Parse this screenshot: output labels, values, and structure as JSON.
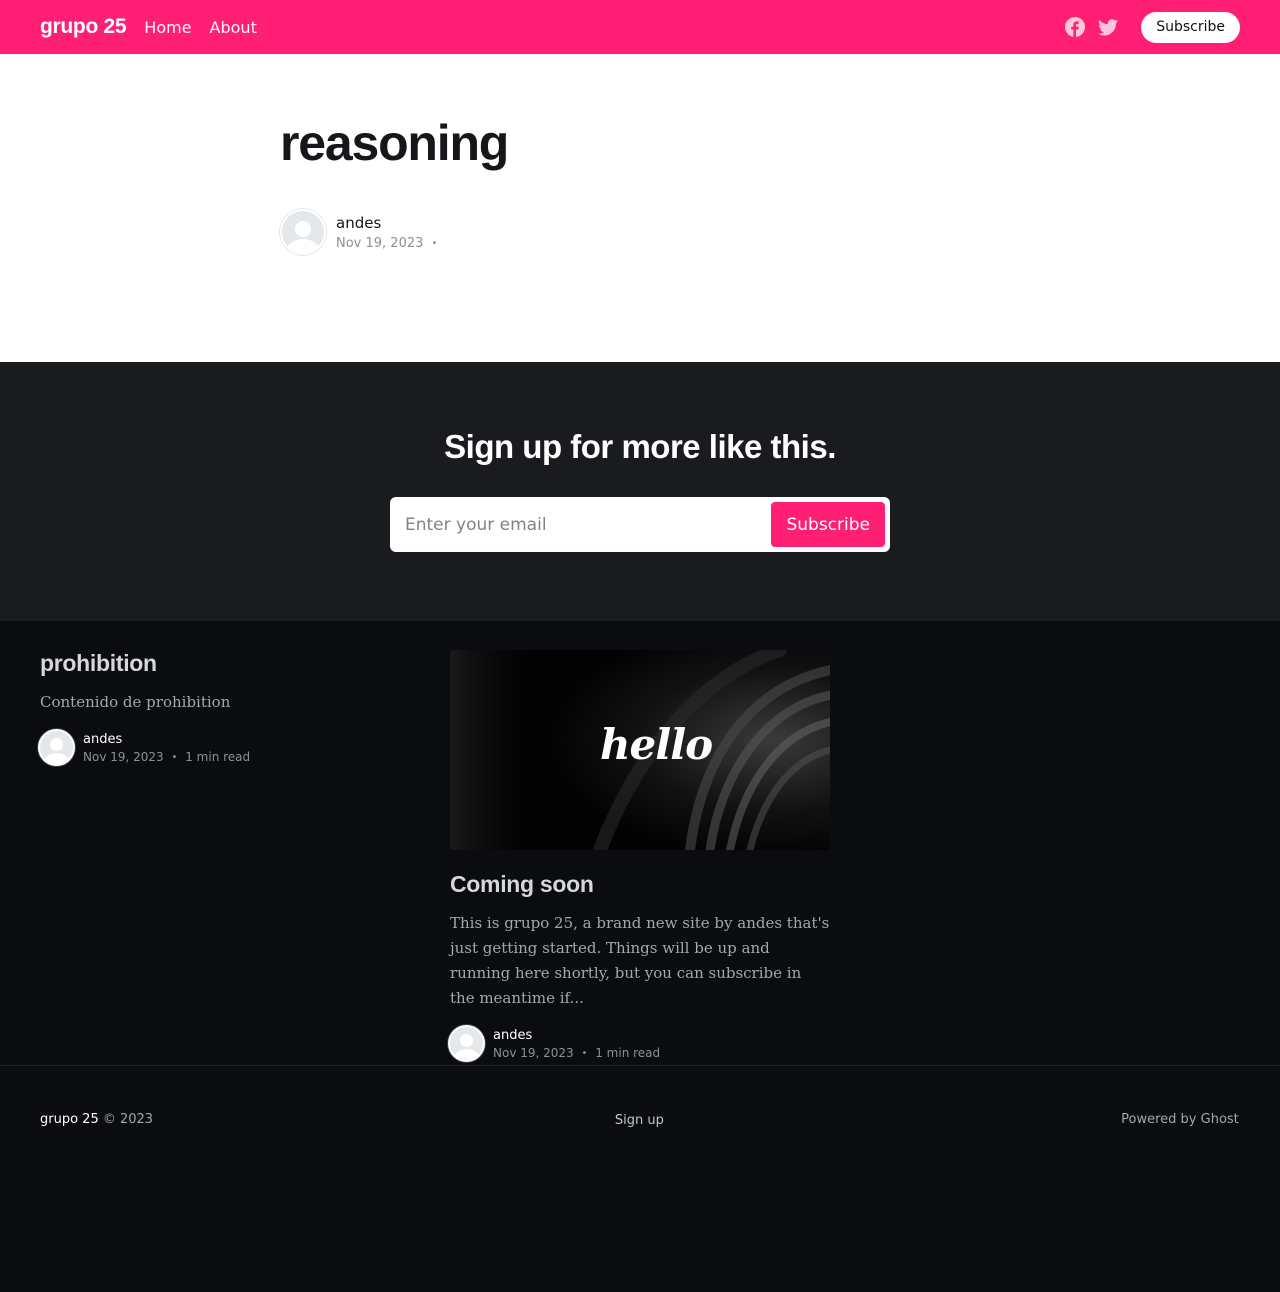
{
  "header": {
    "logo": "grupo 25",
    "nav": [
      "Home",
      "About"
    ],
    "subscribe_label": "Subscribe",
    "social": [
      "facebook-icon",
      "twitter-icon"
    ],
    "accent_color": "#ff1f74"
  },
  "article": {
    "title": "reasoning",
    "author": "andes",
    "date": "Nov 19, 2023",
    "separator": "•"
  },
  "cta": {
    "title": "Sign up for more like this.",
    "email_placeholder": "Enter your email",
    "button_label": "Subscribe"
  },
  "posts": [
    {
      "title": "prohibition",
      "excerpt": "Contenido de prohibition",
      "author": "andes",
      "date": "Nov 19, 2023",
      "separator": "•",
      "read_time": "1 min read"
    },
    {
      "image_text": "hello",
      "title": "Coming soon",
      "excerpt": "This is grupo 25, a brand new site by andes that's just getting started. Things will be up and running here shortly, but you can subscribe in the meantime if...",
      "author": "andes",
      "date": "Nov 19, 2023",
      "separator": "•",
      "read_time": "1 min read"
    }
  ],
  "footer": {
    "brand": "grupo 25",
    "copyright": "© 2023",
    "signup": "Sign up",
    "powered": "Powered by Ghost"
  }
}
